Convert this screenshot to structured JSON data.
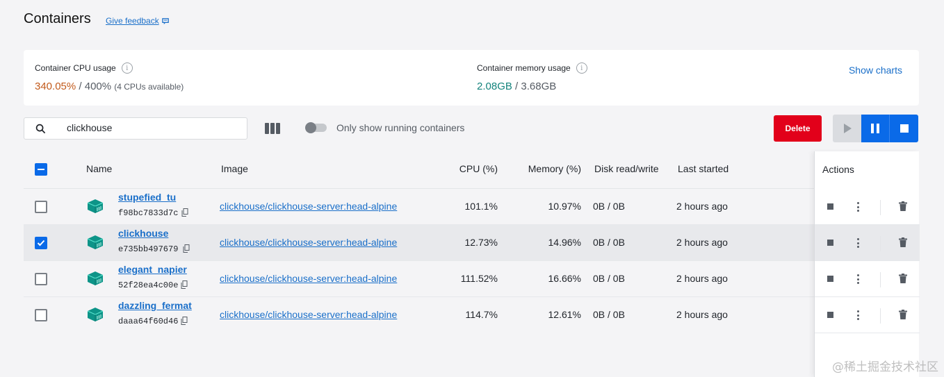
{
  "header": {
    "title": "Containers",
    "feedback_label": "Give feedback"
  },
  "usage": {
    "cpu": {
      "label": "Container CPU usage",
      "used": "340.05%",
      "total": " / 400%",
      "note": "(4 CPUs available)"
    },
    "memory": {
      "label": "Container memory usage",
      "used": "2.08GB",
      "total": " / 3.68GB"
    },
    "show_charts_label": "Show charts"
  },
  "toolbar": {
    "search_value": "clickhouse",
    "running_only_label": "Only show running containers",
    "running_only_enabled": false,
    "delete_label": "Delete"
  },
  "table": {
    "columns": [
      "Name",
      "Image",
      "CPU (%)",
      "Memory (%)",
      "Disk read/write",
      "Last started",
      "Actions"
    ],
    "rows": [
      {
        "name": "stupefied_tu",
        "id": "f98bc7833d7c",
        "image": "clickhouse/clickhouse-server:head-alpine",
        "cpu": "101.1%",
        "memory": "10.97%",
        "disk": "0B / 0B",
        "last_started": "2 hours ago",
        "selected": false
      },
      {
        "name": "clickhouse",
        "id": "e735bb497679",
        "image": "clickhouse/clickhouse-server:head-alpine",
        "cpu": "12.73%",
        "memory": "14.96%",
        "disk": "0B / 0B",
        "last_started": "2 hours ago",
        "selected": true
      },
      {
        "name": "elegant_napier",
        "id": "52f28ea4c00e",
        "image": "clickhouse/clickhouse-server:head-alpine",
        "cpu": "111.52%",
        "memory": "16.66%",
        "disk": "0B / 0B",
        "last_started": "2 hours ago",
        "selected": false
      },
      {
        "name": "dazzling_fermat",
        "id": "daaa64f60d46",
        "image": "clickhouse/clickhouse-server:head-alpine",
        "cpu": "114.7%",
        "memory": "12.61%",
        "disk": "0B / 0B",
        "last_started": "2 hours ago",
        "selected": false
      }
    ]
  },
  "colors": {
    "accent": "#0a6ae8",
    "delete": "#e2001a",
    "cpu_used": "#c25a1b",
    "mem_used": "#13837c",
    "container_icon": "#0d9488"
  },
  "icons": [
    "feedback-icon",
    "info-icon",
    "search-icon",
    "columns-icon",
    "play-icon",
    "pause-icon",
    "stop-icon",
    "container-icon",
    "copy-icon",
    "more-vertical-icon",
    "trash-icon"
  ],
  "watermark": "@稀土掘金技术社区"
}
